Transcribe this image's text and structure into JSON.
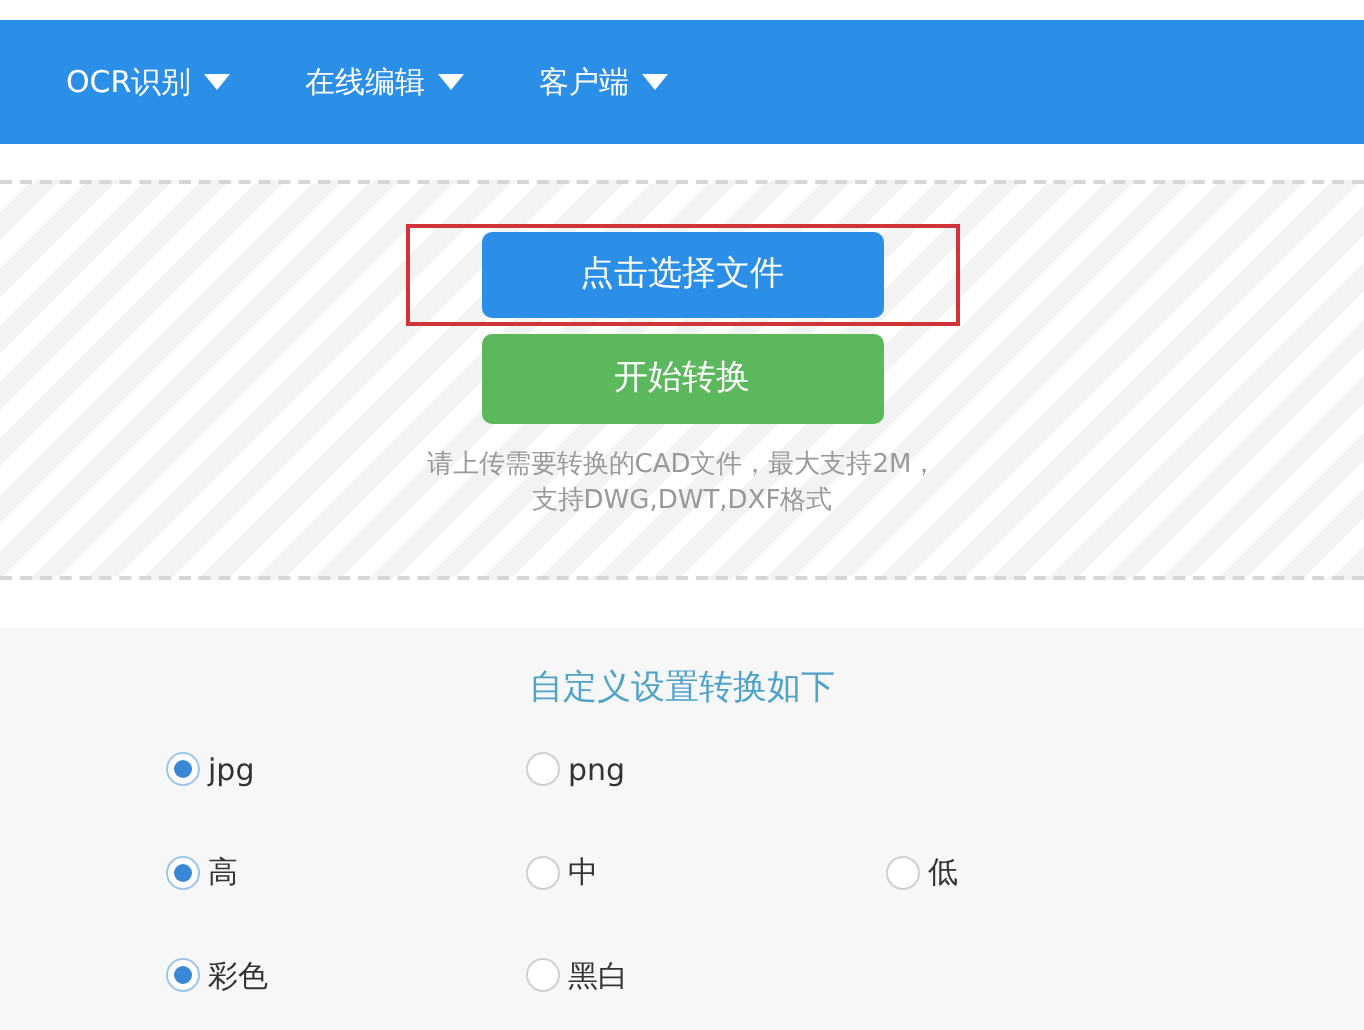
{
  "nav": {
    "items": [
      {
        "label": "OCR识别"
      },
      {
        "label": "在线编辑"
      },
      {
        "label": "客户端"
      }
    ]
  },
  "upload": {
    "choose_button": {
      "label": "点击选择文件",
      "highlighted": true
    },
    "convert_button": {
      "label": "开始转换"
    },
    "hint_lines": [
      "请上传需要转换的CAD文件，最大支持2M，",
      "支持DWG,DWT,DXF格式"
    ]
  },
  "settings": {
    "title": "自定义设置转换如下",
    "groups": [
      {
        "options": [
          {
            "label": "jpg",
            "selected": true
          },
          {
            "label": "png",
            "selected": false
          }
        ]
      },
      {
        "options": [
          {
            "label": "高",
            "selected": true
          },
          {
            "label": "中",
            "selected": false
          },
          {
            "label": "低",
            "selected": false
          }
        ]
      },
      {
        "options": [
          {
            "label": "彩色",
            "selected": true
          },
          {
            "label": "黑白",
            "selected": false
          }
        ]
      }
    ]
  }
}
